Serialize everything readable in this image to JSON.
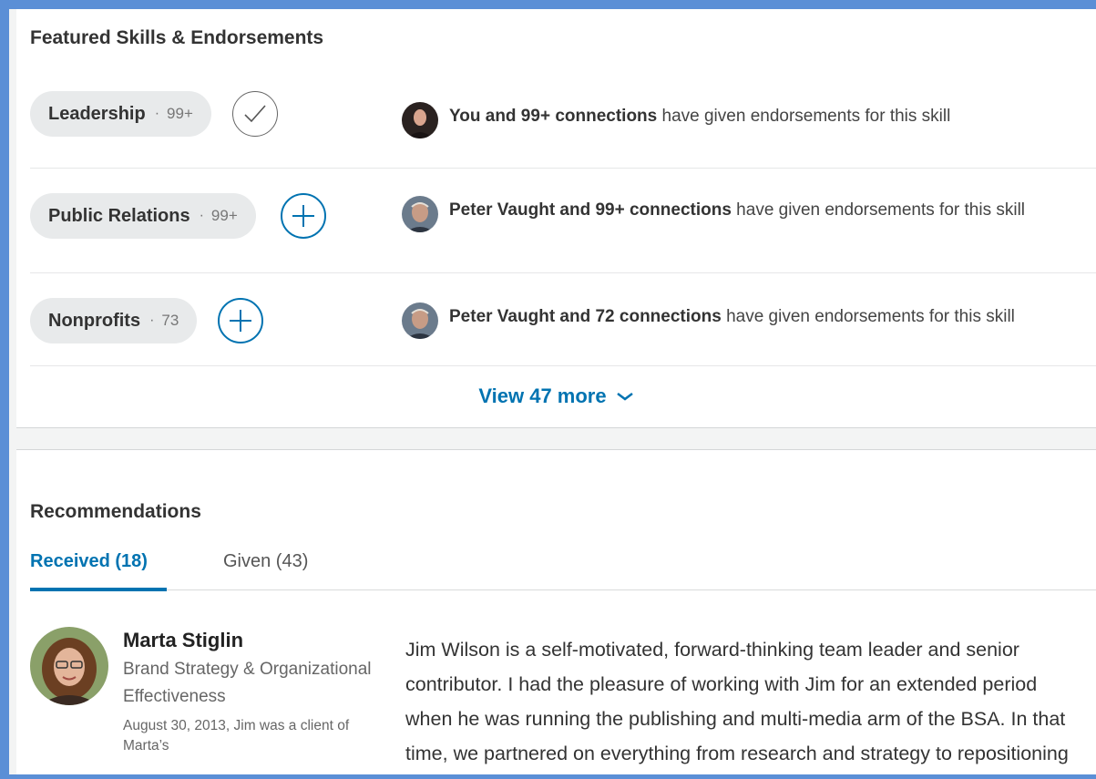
{
  "skills": {
    "title": "Featured Skills & Endorsements",
    "items": [
      {
        "name": "Leadership",
        "count": "99+",
        "action": "check",
        "endorser": "You and 99+ connections",
        "suffix": " have given endorsements for this skill"
      },
      {
        "name": "Public Relations",
        "count": "99+",
        "action": "plus",
        "endorser": "Peter Vaught and 99+ connections",
        "suffix": " have given endorsements for this skill"
      },
      {
        "name": "Nonprofits",
        "count": "73",
        "action": "plus",
        "endorser": "Peter Vaught and 72 connections",
        "suffix": " have given endorsements for this skill"
      }
    ],
    "view_more_label": "View 47 more"
  },
  "recommendations": {
    "title": "Recommendations",
    "tabs": [
      {
        "label": "Received (18)",
        "active": true
      },
      {
        "label": "Given (43)",
        "active": false
      }
    ],
    "entry": {
      "name": "Marta Stiglin",
      "headline": "Brand Strategy & Organizational Effectiveness",
      "meta": "August 30, 2013, Jim was a client of Marta’s",
      "text": "Jim Wilson is a self-motivated, forward-thinking team leader and senior contributor. I had the pleasure of working with Jim for an extended period when he was running the publishing and multi-media arm of the BSA. In that time, we partnered on everything from research and strategy to repositioning and fundraising efforts."
    }
  },
  "colors": {
    "accent": "#0073b1",
    "frame": "#5b8fd6",
    "pill": "#e8eaeb"
  }
}
